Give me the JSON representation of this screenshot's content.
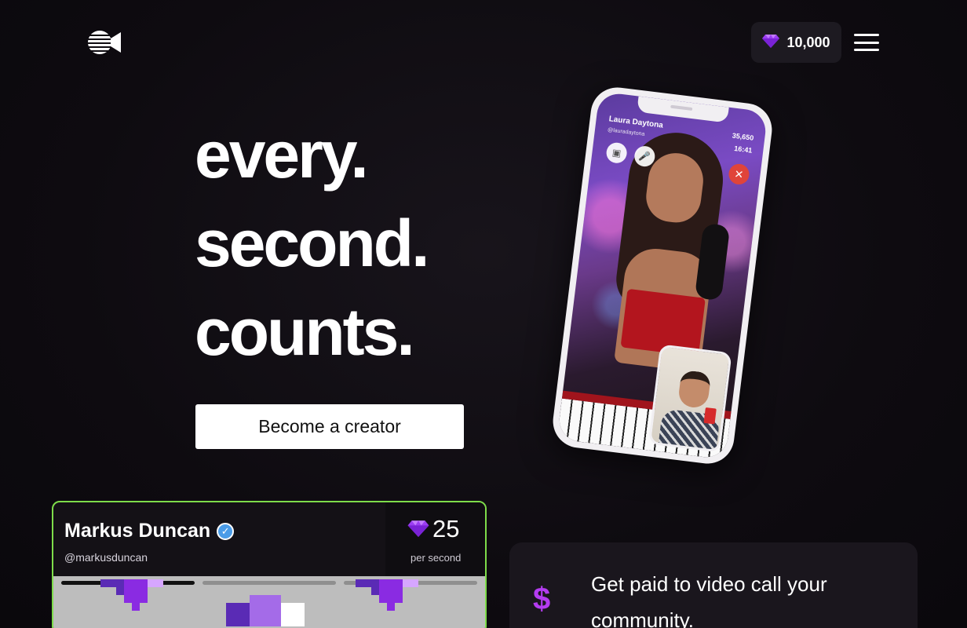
{
  "header": {
    "logo_icon": "camera-logo-icon",
    "balance": {
      "icon": "diamond-icon",
      "amount": "10,000"
    },
    "menu_icon": "hamburger-menu-icon"
  },
  "hero": {
    "line1": "every.",
    "line2": "second.",
    "line3": "counts.",
    "cta_label": "Become a creator"
  },
  "phone_preview": {
    "caller_name": "Laura Daytona",
    "caller_handle": "@lauradaytona",
    "gems": "35,650",
    "timer": "16:41",
    "buttons": [
      "video-camera-icon",
      "microphone-icon",
      "end-call-icon"
    ]
  },
  "creator_card": {
    "name": "Markus Duncan",
    "handle": "@markusduncan",
    "rate_value": "25",
    "rate_label": "per second",
    "accent_color": "#7edc4a"
  },
  "feature": {
    "icon_glyph": "$",
    "text": "Get paid to video call your community."
  },
  "colors": {
    "background": "#0e0b10",
    "diamond": "#9b3df2",
    "dollar": "#b43cf0"
  }
}
